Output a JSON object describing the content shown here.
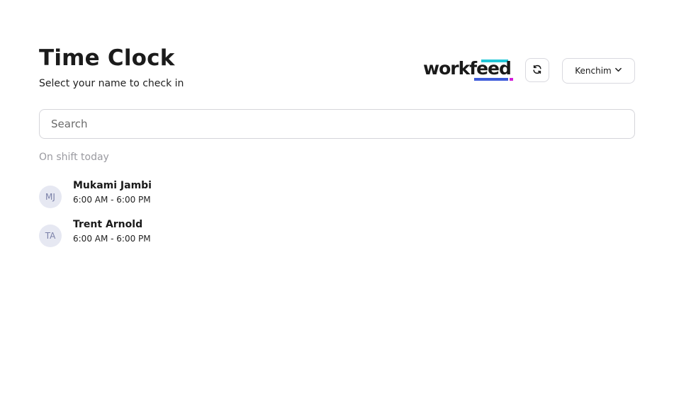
{
  "header": {
    "title": "Time Clock",
    "subtitle": "Select your name to check in"
  },
  "logo": {
    "text": "workfeed",
    "colors": {
      "top_bar": "#22c7d8",
      "bottom_bar": "#3d5bd9",
      "dot": "#d21fd8"
    }
  },
  "toolbar": {
    "refresh_icon": "refresh-icon",
    "location_label": "Kenchim",
    "location_icon": "chevron-down-icon"
  },
  "search": {
    "placeholder": "Search",
    "value": ""
  },
  "section": {
    "label": "On shift today"
  },
  "employees": [
    {
      "initials": "MJ",
      "name": "Mukami Jambi",
      "shift": "6:00 AM - 6:00 PM"
    },
    {
      "initials": "TA",
      "name": "Trent Arnold",
      "shift": "6:00 AM - 6:00 PM"
    }
  ]
}
